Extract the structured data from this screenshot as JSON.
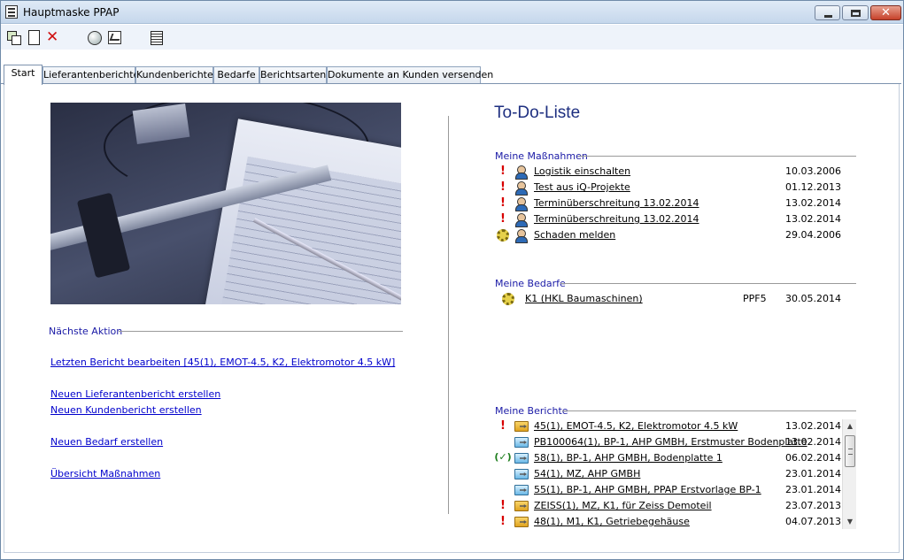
{
  "window": {
    "title": "Hauptmaske PPAP",
    "close_glyph": "✕"
  },
  "toolbar": {
    "icons": [
      "save-icon",
      "new-document-icon",
      "delete-icon",
      "globe-icon",
      "report-icon",
      "calculator-icon"
    ],
    "delete_glyph": "✕"
  },
  "tabs": [
    {
      "label": "Start"
    },
    {
      "label": "Lieferantenberichte"
    },
    {
      "label": "Kundenberichte"
    },
    {
      "label": "Bedarfe"
    },
    {
      "label": "Berichtsarten"
    },
    {
      "label": "Dokumente an Kunden versenden"
    }
  ],
  "left": {
    "next_action_label": "Nächste Aktion",
    "links": [
      "Letzten Bericht bearbeiten [45(1), EMOT-4.5, K2, Elektromotor 4.5 kW]",
      "Neuen Lieferantenbericht erstellen",
      "Neuen Kundenbericht erstellen",
      "Neuen Bedarf erstellen",
      "Übersicht Maßnahmen"
    ]
  },
  "todo": {
    "title": "To-Do-Liste",
    "massnahmen_label": "Meine Maßnahmen",
    "massnahmen": [
      {
        "mark": "!",
        "text": "Logistik einschalten",
        "date": "10.03.2006"
      },
      {
        "mark": "!",
        "text": "Test aus iQ-Projekte",
        "date": "01.12.2013"
      },
      {
        "mark": "!",
        "text": "Terminüberschreitung 13.02.2014",
        "date": "13.02.2014"
      },
      {
        "mark": "!",
        "text": "Terminüberschreitung 13.02.2014",
        "date": "13.02.2014"
      },
      {
        "mark": "",
        "text": "Schaden melden",
        "date": "29.04.2006"
      }
    ],
    "bedarfe_label": "Meine Bedarfe",
    "bedarfe": [
      {
        "text": "K1 (HKL Baumaschinen)",
        "code": "PPF5",
        "date": "30.05.2014"
      }
    ],
    "berichte_label": "Meine Berichte",
    "berichte": [
      {
        "mark": "!",
        "text": "45(1), EMOT-4.5, K2, Elektromotor 4.5 kW",
        "date": "13.02.2014",
        "folder": "yellow"
      },
      {
        "mark": "",
        "text": "PB100064(1), BP-1, AHP GMBH, Erstmuster Bodenplatte",
        "date": "13.02.2014",
        "folder": "blue"
      },
      {
        "mark": "(✓)",
        "text": "58(1), BP-1, AHP GMBH, Bodenplatte 1",
        "date": "06.02.2014",
        "folder": "blue"
      },
      {
        "mark": "",
        "text": "54(1), MZ, AHP GMBH",
        "date": "23.01.2014",
        "folder": "blue"
      },
      {
        "mark": "",
        "text": "55(1), BP-1, AHP GMBH, PPAP Erstvorlage BP-1",
        "date": "23.01.2014",
        "folder": "blue"
      },
      {
        "mark": "!",
        "text": "ZEISS(1), MZ, K1, für Zeiss Demoteil",
        "date": "23.07.2013",
        "folder": "yellow"
      },
      {
        "mark": "!",
        "text": "48(1), M1, K1, Getriebegehäuse",
        "date": "04.07.2013",
        "folder": "yellow"
      }
    ]
  },
  "scrollbar": {
    "up_glyph": "▲",
    "down_glyph": "▼"
  }
}
